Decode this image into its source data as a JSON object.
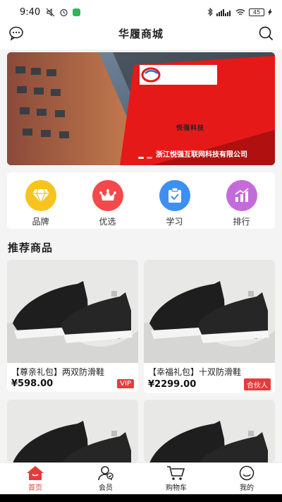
{
  "status_bar": {
    "time": "9:40",
    "battery": "45"
  },
  "header": {
    "title": "华履商城"
  },
  "banner": {
    "company": "浙江悦强互联网科技有限公司",
    "logo_text": "悦强科技"
  },
  "categories": [
    {
      "label": "品牌",
      "icon": "diamond-icon",
      "color": "#f5c21c"
    },
    {
      "label": "优选",
      "icon": "crown-icon",
      "color": "#f04848"
    },
    {
      "label": "学习",
      "icon": "clipboard-check-icon",
      "color": "#3c8ef0"
    },
    {
      "label": "排行",
      "icon": "bar-chart-icon",
      "color": "#c06ad8"
    }
  ],
  "section": {
    "title": "推荐商品"
  },
  "products": [
    {
      "name": "【尊亲礼包】两双防滑鞋",
      "price": "¥598.00",
      "badge": "VIP"
    },
    {
      "name": "【幸福礼包】十双防滑鞋",
      "price": "¥2299.00",
      "badge": "合伙人"
    },
    {
      "name": "",
      "price": "",
      "badge": ""
    },
    {
      "name": "",
      "price": "",
      "badge": ""
    }
  ],
  "nav": [
    {
      "label": "首页",
      "icon": "home-icon",
      "active": true
    },
    {
      "label": "会员",
      "icon": "member-icon",
      "active": false
    },
    {
      "label": "购物车",
      "icon": "cart-icon",
      "active": false
    },
    {
      "label": "我的",
      "icon": "profile-icon",
      "active": false
    }
  ],
  "colors": {
    "accent": "#e63b3b",
    "background": "#f4f4f4"
  }
}
